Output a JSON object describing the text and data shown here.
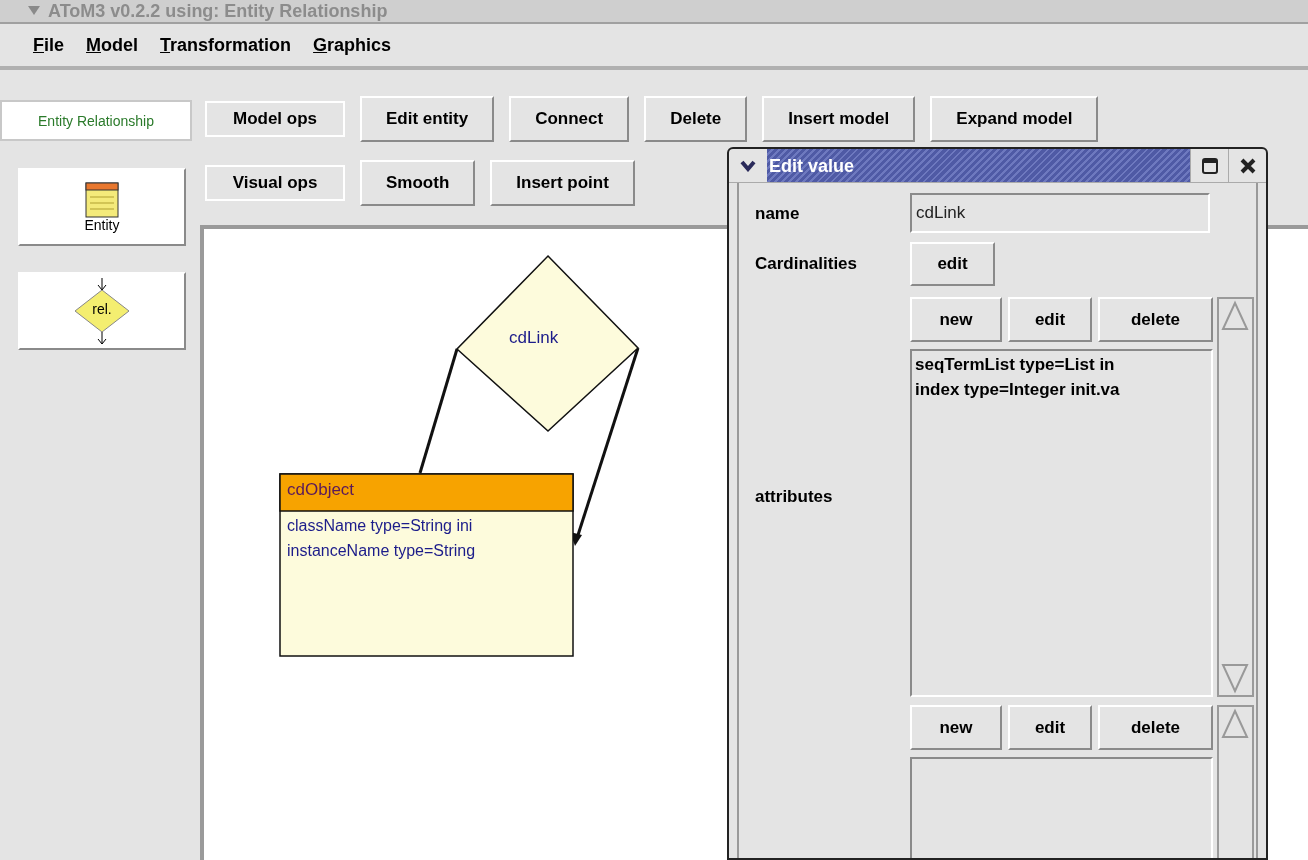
{
  "window": {
    "title": "AToM3 v0.2.2 using: Entity Relationship"
  },
  "menu": [
    {
      "label": "File"
    },
    {
      "label": "Model"
    },
    {
      "label": "Transformation"
    },
    {
      "label": "Graphics"
    }
  ],
  "formalism_tab": {
    "label": "Entity Relationship"
  },
  "toolbar_rows": [
    {
      "label": "Model ops",
      "buttons": [
        "Edit entity",
        "Connect",
        "Delete",
        "Insert model",
        "Expand model"
      ]
    },
    {
      "label": "Visual ops",
      "buttons": [
        "Smooth",
        "Insert point"
      ]
    }
  ],
  "palette": [
    {
      "kind": "entity",
      "label": "Entity"
    },
    {
      "kind": "relationship",
      "label": "rel."
    }
  ],
  "diagram": {
    "relationship": {
      "name": "cdLink"
    },
    "entity": {
      "name": "cdObject",
      "attributes": [
        "className type=String ini",
        "instanceName type=String"
      ]
    }
  },
  "dialog": {
    "title": "Edit value",
    "rows": [
      {
        "kind": "text",
        "label": "name",
        "value": "cdLink"
      },
      {
        "kind": "button",
        "label": "Cardinalities",
        "button": "edit"
      },
      {
        "kind": "list",
        "label": "attributes",
        "buttons": [
          "new",
          "edit",
          "delete"
        ],
        "items": [
          "seqTermList type=List in",
          "index type=Integer init.va"
        ]
      },
      {
        "kind": "list",
        "buttons": [
          "new",
          "edit",
          "delete"
        ]
      }
    ]
  }
}
